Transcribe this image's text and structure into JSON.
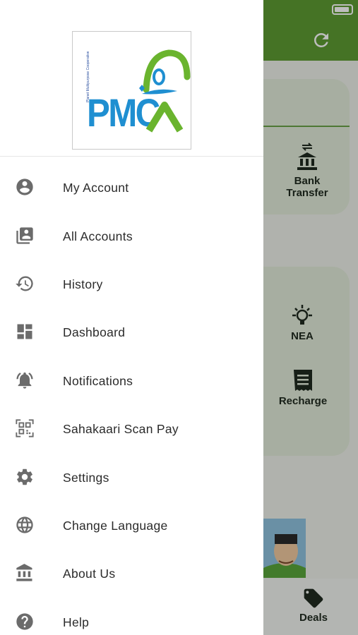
{
  "background_app": {
    "tiles": {
      "bank_transfer": "Bank Transfer",
      "nea": "NEA",
      "recharge": "Recharge"
    },
    "bottom_nav": {
      "deals": "Deals"
    }
  },
  "drawer": {
    "logo": {
      "text": "PMC",
      "tagline": "Planet Multipurpose Cooperative"
    },
    "menu": [
      {
        "label": "My Account",
        "icon": "account-circle-icon"
      },
      {
        "label": "All Accounts",
        "icon": "account-box-multiple-icon"
      },
      {
        "label": "History",
        "icon": "history-icon"
      },
      {
        "label": "Dashboard",
        "icon": "dashboard-icon"
      },
      {
        "label": "Notifications",
        "icon": "notifications-active-icon"
      },
      {
        "label": "Sahakaari Scan Pay",
        "icon": "qr-code-scan-icon"
      },
      {
        "label": "Settings",
        "icon": "settings-gear-icon"
      },
      {
        "label": "Change Language",
        "icon": "globe-icon"
      },
      {
        "label": "About Us",
        "icon": "institution-icon"
      },
      {
        "label": "Help",
        "icon": "help-circle-icon"
      }
    ]
  },
  "colors": {
    "header_green": "#5d9b32",
    "icon_gray": "#6b6b6b",
    "logo_blue": "#1f8fd1",
    "logo_green": "#6ab42e"
  }
}
